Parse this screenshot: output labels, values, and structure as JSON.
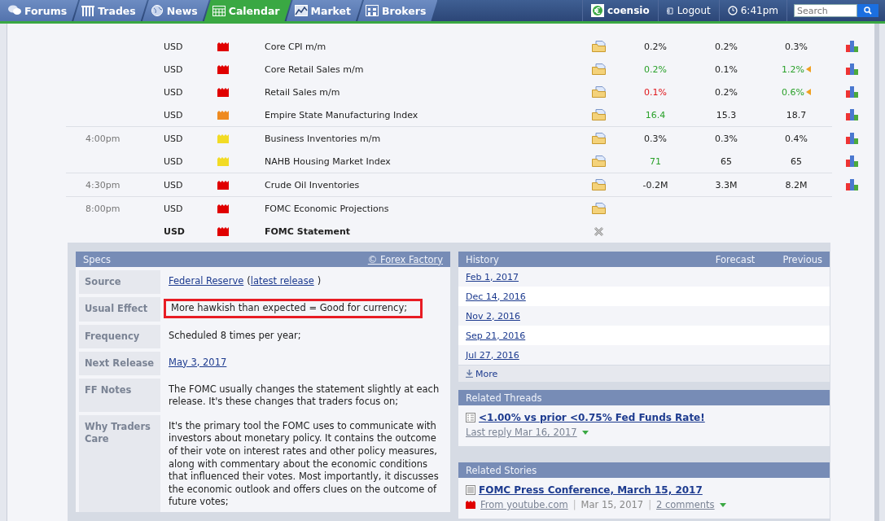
{
  "nav": {
    "tabs": [
      {
        "label": "Forums",
        "selected": false
      },
      {
        "label": "Trades",
        "selected": false
      },
      {
        "label": "News",
        "selected": false
      },
      {
        "label": "Calendar",
        "selected": true
      },
      {
        "label": "Market",
        "selected": false
      },
      {
        "label": "Brokers",
        "selected": false
      }
    ],
    "user": "coensio",
    "logout": "Logout",
    "time": "6:41pm",
    "search": {
      "placeholder": "Search"
    }
  },
  "calendar": {
    "groups": [
      {
        "rows": [
          {
            "currency": "USD",
            "color": "#e00000",
            "event": "Core CPI m/m",
            "bold": false,
            "expanded": false,
            "actual": "0.2%",
            "actual_better": false,
            "actual_worse": false,
            "forecast": "0.2%",
            "previous": "0.3%",
            "previous_better": false,
            "graph": true
          },
          {
            "currency": "USD",
            "color": "#e00000",
            "event": "Core Retail Sales m/m",
            "bold": false,
            "expanded": false,
            "actual": "0.2%",
            "actual_better": true,
            "actual_worse": false,
            "forecast": "0.1%",
            "previous": "1.2%",
            "previous_better": true,
            "previous_revised": true,
            "graph": true
          },
          {
            "currency": "USD",
            "color": "#e00000",
            "event": "Retail Sales m/m",
            "bold": false,
            "expanded": false,
            "actual": "0.1%",
            "actual_better": false,
            "actual_worse": true,
            "forecast": "0.2%",
            "previous": "0.6%",
            "previous_better": true,
            "previous_revised": true,
            "graph": true
          },
          {
            "currency": "USD",
            "color": "#ee8a20",
            "event": "Empire State Manufacturing Index",
            "bold": false,
            "expanded": false,
            "actual": "16.4",
            "actual_better": true,
            "actual_worse": false,
            "forecast": "15.3",
            "previous": "18.7",
            "previous_better": false,
            "graph": true
          }
        ]
      },
      {
        "time": "4:00pm",
        "rows": [
          {
            "currency": "USD",
            "color": "#f2db25",
            "event": "Business Inventories m/m",
            "bold": false,
            "expanded": false,
            "actual": "0.3%",
            "actual_better": false,
            "actual_worse": false,
            "forecast": "0.3%",
            "previous": "0.4%",
            "previous_better": false,
            "graph": true
          },
          {
            "currency": "USD",
            "color": "#f2db25",
            "event": "NAHB Housing Market Index",
            "bold": false,
            "expanded": false,
            "actual": "71",
            "actual_better": true,
            "actual_worse": false,
            "forecast": "65",
            "previous": "65",
            "previous_better": false,
            "graph": true
          }
        ]
      },
      {
        "time": "4:30pm",
        "rows": [
          {
            "currency": "USD",
            "color": "#e00000",
            "event": "Crude Oil Inventories",
            "bold": false,
            "expanded": false,
            "actual": "-0.2M",
            "actual_better": false,
            "actual_worse": false,
            "forecast": "3.3M",
            "previous": "8.2M",
            "previous_better": false,
            "graph": true
          }
        ]
      },
      {
        "time": "8:00pm",
        "rows": [
          {
            "currency": "USD",
            "color": "#e00000",
            "event": "FOMC Economic Projections",
            "bold": false,
            "expanded": false
          },
          {
            "currency": "USD",
            "color": "#e00000",
            "event": "FOMC Statement",
            "bold": true,
            "expanded": true
          }
        ]
      }
    ]
  },
  "specs": {
    "title": "Specs",
    "credit": "© Forex Factory",
    "rows": [
      {
        "label": "Source",
        "highlighted": false,
        "parts": [
          {
            "text": "Federal Reserve",
            "link": true
          },
          {
            "text": "(",
            "link": false
          },
          {
            "text": "latest release",
            "link": true
          },
          {
            "text": ")",
            "link": false
          }
        ]
      },
      {
        "label": "Usual Effect",
        "highlighted": true,
        "parts": [
          {
            "text": "More hawkish than expected = Good for currency;",
            "link": false
          }
        ]
      },
      {
        "label": "Frequency",
        "highlighted": false,
        "parts": [
          {
            "text": "Scheduled 8 times per year;",
            "link": false
          }
        ]
      },
      {
        "label": "Next Release",
        "highlighted": false,
        "parts": [
          {
            "text": "May 3, 2017",
            "link": true
          }
        ]
      },
      {
        "label": "FF Notes",
        "highlighted": false,
        "parts": [
          {
            "text": "The FOMC usually changes the statement slightly at each release. It's these changes that traders focus on;",
            "link": false
          }
        ]
      },
      {
        "label": "Why Traders Care",
        "highlighted": false,
        "parts": [
          {
            "text": "It's the primary tool the FOMC uses to communicate with investors about monetary policy. It contains the outcome of their vote on interest rates and other policy measures, along with commentary about the economic conditions that influenced their votes. Most importantly, it discusses the economic outlook and offers clues on the outcome of future votes;",
            "link": false
          }
        ]
      }
    ]
  },
  "history": {
    "columns": [
      "History",
      "Forecast",
      "Previous"
    ],
    "dates": [
      "Feb 1, 2017",
      "Dec 14, 2016",
      "Nov 2, 2016",
      "Sep 21, 2016",
      "Jul 27, 2016"
    ],
    "more": "More"
  },
  "related_threads": {
    "title": "Related Threads",
    "items": [
      {
        "title": "<1.00% vs prior <0.75% Fed Funds Rate!",
        "meta": "Last reply Mar 16, 2017"
      }
    ]
  },
  "related_stories": {
    "title": "Related Stories",
    "items": [
      {
        "title": "FOMC Press Conference, March 15, 2017",
        "source": "From youtube.com",
        "separator_1": "|",
        "date": "Mar 15, 2017",
        "separator_2": "|",
        "comments": "2 comments"
      }
    ]
  }
}
